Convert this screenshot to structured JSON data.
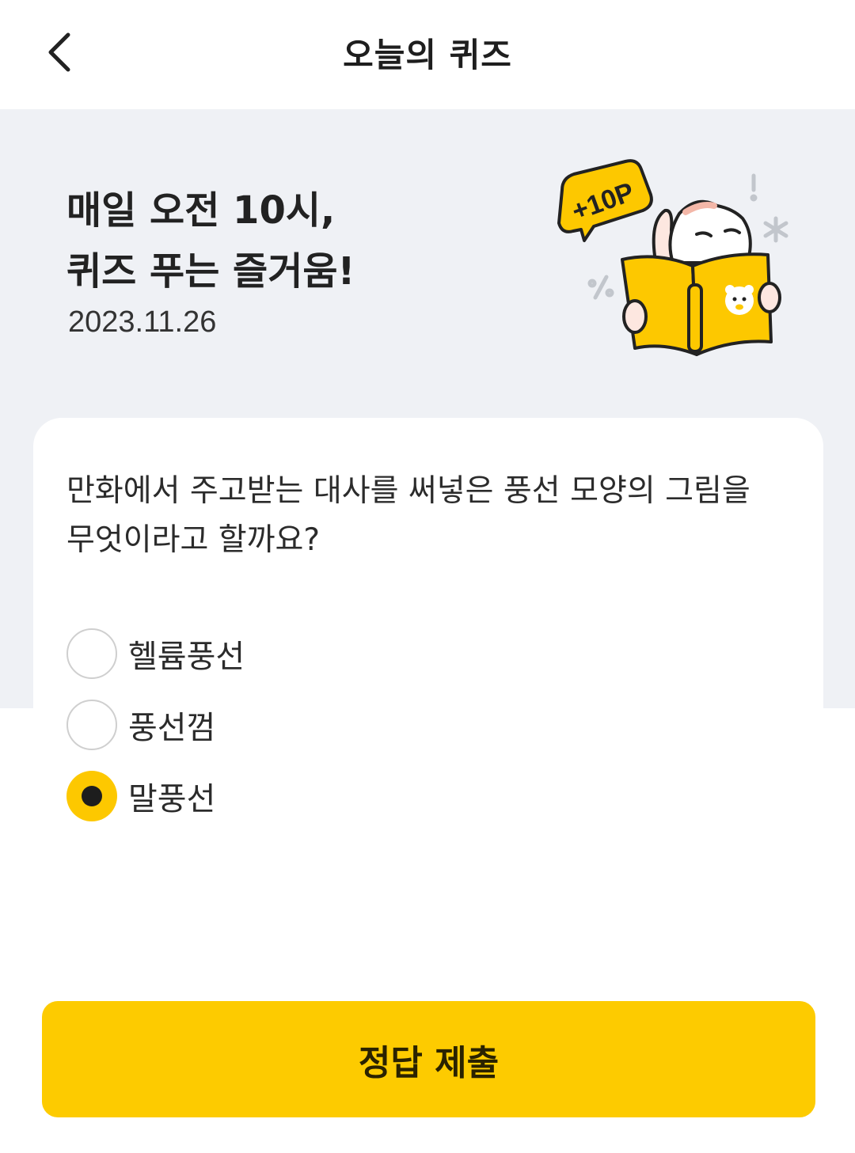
{
  "header": {
    "title": "오늘의 퀴즈",
    "back_icon": "chevron-left-icon"
  },
  "hero": {
    "title_line1": "매일 오전 10시,",
    "title_line2": "퀴즈 푸는 즐거움!",
    "date": "2023.11.26",
    "badge": "+10P"
  },
  "quiz": {
    "question_line1": "만화에서 주고받는 대사를 써넣은 풍선 모양의 그림을",
    "question_line2": "무엇이라고 할까요?",
    "options": [
      {
        "label": "헬륨풍선",
        "selected": false
      },
      {
        "label": "풍선껌",
        "selected": false
      },
      {
        "label": "말풍선",
        "selected": true
      }
    ]
  },
  "submit": {
    "label": "정답 제출"
  },
  "colors": {
    "accent": "#fdcb00",
    "hero_background": "#eff1f5",
    "radio_border": "#cfcfcf"
  }
}
